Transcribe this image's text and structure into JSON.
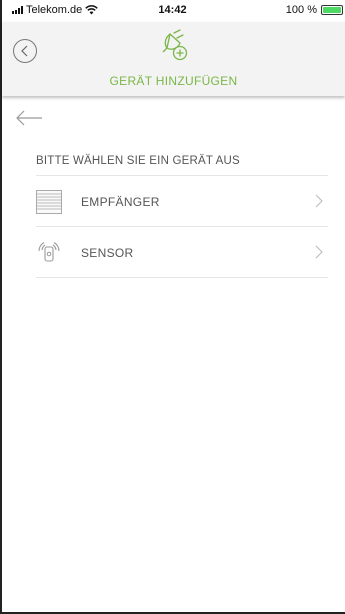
{
  "status_bar": {
    "carrier": "Telekom.de",
    "time": "14:42",
    "battery": "100 %",
    "icons": [
      "signal-icon",
      "wifi-icon",
      "battery-icon"
    ]
  },
  "header": {
    "title": "GERÄT HINZUFÜGEN",
    "icons": [
      "back-circle-icon",
      "plug-add-icon"
    ]
  },
  "content": {
    "section_title": "BITTE WÄHLEN SIE EIN GERÄT AUS",
    "devices": [
      {
        "label": "EMPFÄNGER",
        "icon": "blinds-icon"
      },
      {
        "label": "SENSOR",
        "icon": "sensor-icon"
      }
    ]
  },
  "colors": {
    "accent": "#7ab648",
    "header_bg": "#f3f3f3",
    "text": "#555555",
    "battery": "#4cd964"
  }
}
